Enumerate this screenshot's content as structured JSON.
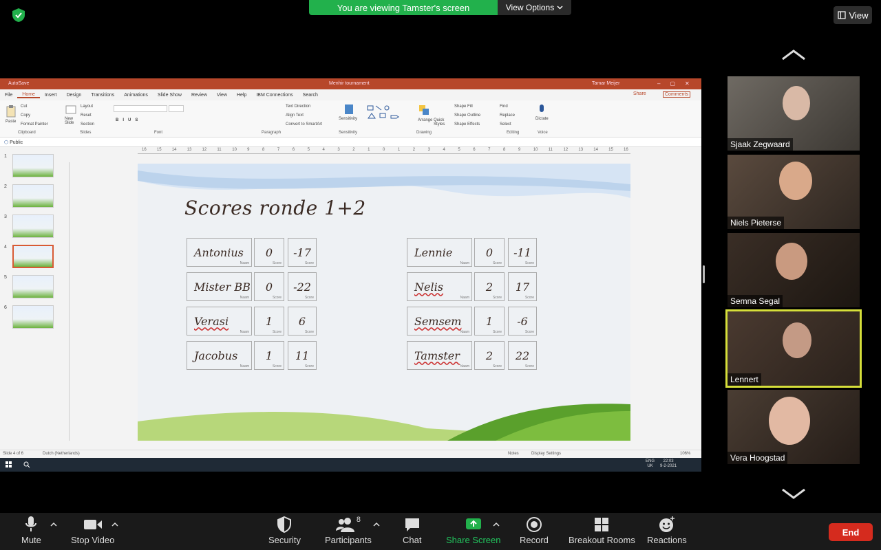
{
  "meeting": {
    "banner_text": "You are viewing Tamster's screen",
    "view_options_label": "View Options",
    "view_label": "View"
  },
  "ppt": {
    "autosave_label": "AutoSave",
    "document_title": "Menhir tournament",
    "user_name": "Tamar Meijer",
    "tabs": [
      "File",
      "Home",
      "Insert",
      "Design",
      "Transitions",
      "Animations",
      "Slide Show",
      "Review",
      "View",
      "Help",
      "IBM Connections",
      "Search"
    ],
    "active_tab": "Home",
    "share_label": "Share",
    "comments_label": "Comments",
    "ribbon_groups": [
      "Clipboard",
      "Slides",
      "Font",
      "Paragraph",
      "Sensitivity",
      "Drawing",
      "Editing",
      "Voice"
    ],
    "ribbon_labels": {
      "paste": "Paste",
      "new_slide": "New Slide",
      "layout": "Layout",
      "reset": "Reset",
      "section": "Section",
      "cut": "Cut",
      "copy": "Copy",
      "format_painter": "Format Painter",
      "text_direction": "Text Direction",
      "align_text": "Align Text",
      "smartart": "Convert to SmartArt",
      "sensitivity": "Sensitivity",
      "arrange": "Arrange",
      "quick_styles": "Quick Styles",
      "shape_fill": "Shape Fill",
      "shape_outline": "Shape Outline",
      "shape_effects": "Shape Effects",
      "find": "Find",
      "replace": "Replace",
      "select": "Select",
      "dictate": "Dictate"
    },
    "public_label": "Public",
    "thumbnails": [
      "1",
      "2",
      "3",
      "4",
      "5",
      "6"
    ],
    "selected_thumbnail": 4,
    "ruler_ticks": [
      "16",
      "15",
      "14",
      "13",
      "12",
      "11",
      "10",
      "9",
      "8",
      "7",
      "6",
      "5",
      "4",
      "3",
      "2",
      "1",
      "0",
      "1",
      "2",
      "3",
      "4",
      "5",
      "6",
      "7",
      "8",
      "9",
      "10",
      "11",
      "12",
      "13",
      "14",
      "15",
      "16"
    ],
    "status_slide": "Slide 4 of 6",
    "status_language": "Dutch (Netherlands)",
    "status_notes": "Notes",
    "status_display": "Display Settings",
    "status_zoom": "106%",
    "taskbar_lang": "ENG",
    "taskbar_region": "UK",
    "taskbar_time": "22:03",
    "taskbar_date": "9-2-2021"
  },
  "slide": {
    "title": "Scores ronde 1+2",
    "name_caption": "Naam",
    "score_caption": "Score",
    "left": [
      {
        "name": "Antonius",
        "s1": "0",
        "s2": "-17",
        "underline": false
      },
      {
        "name": "Mister BB",
        "s1": "0",
        "s2": "-22",
        "underline": false
      },
      {
        "name": "Verasi",
        "s1": "1",
        "s2": "6",
        "underline": true
      },
      {
        "name": "Jacobus",
        "s1": "1",
        "s2": "11",
        "underline": false
      }
    ],
    "right": [
      {
        "name": "Lennie",
        "s1": "0",
        "s2": "-11",
        "underline": false
      },
      {
        "name": "Nelis",
        "s1": "2",
        "s2": "17",
        "underline": true
      },
      {
        "name": "Semsem",
        "s1": "1",
        "s2": "-6",
        "underline": true
      },
      {
        "name": "Tamster",
        "s1": "2",
        "s2": "22",
        "underline": true
      }
    ]
  },
  "participants": [
    {
      "name": "Sjaak Zegwaard",
      "active": false
    },
    {
      "name": "Niels Pieterse",
      "active": false
    },
    {
      "name": "Semna Segal",
      "active": false
    },
    {
      "name": "Lennert",
      "active": true
    },
    {
      "name": "Vera Hoogstad",
      "active": false
    }
  ],
  "toolbar": {
    "mute": "Mute",
    "stop_video": "Stop Video",
    "security": "Security",
    "participants": "Participants",
    "participant_count": "8",
    "chat": "Chat",
    "share_screen": "Share Screen",
    "record": "Record",
    "breakout_rooms": "Breakout Rooms",
    "reactions": "Reactions",
    "end": "End"
  },
  "colors": {
    "banner_green": "#22b14c",
    "ppt_accent": "#b7472a",
    "active_speaker": "#d6df3a",
    "end_red": "#d52b1e"
  }
}
